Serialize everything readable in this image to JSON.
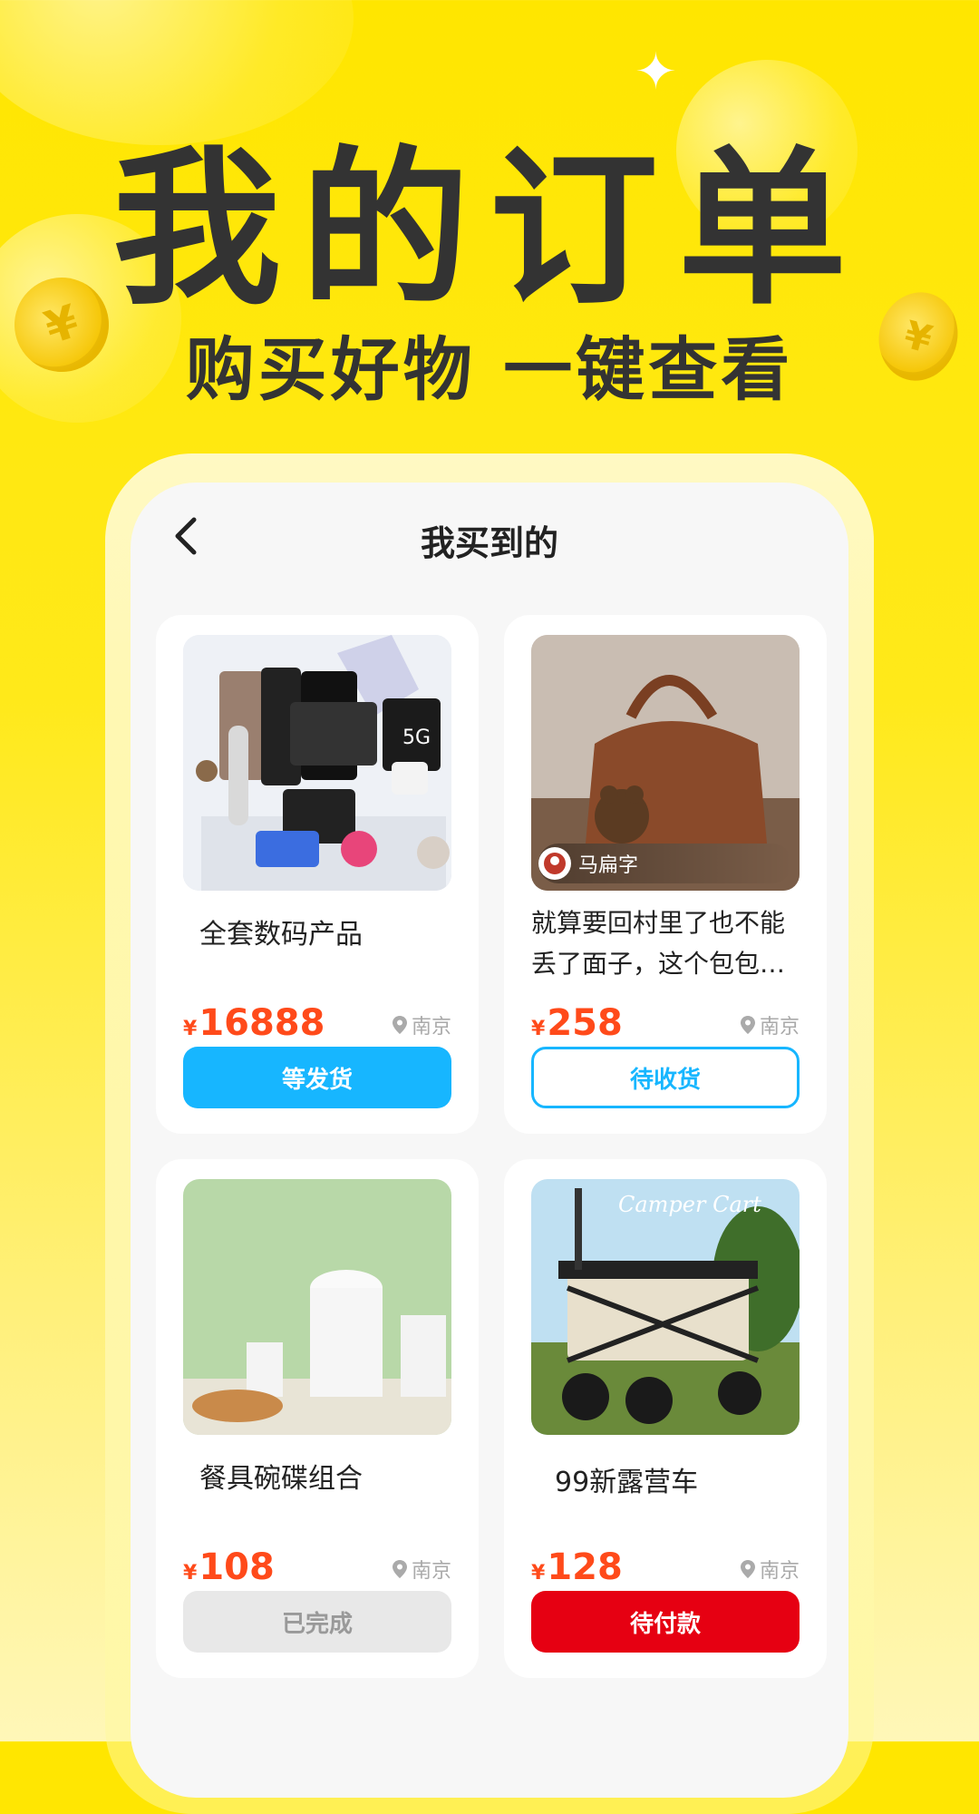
{
  "hero": {
    "title": "我的订单",
    "subtitle": "购买好物 一键查看"
  },
  "decor": {
    "coin_symbol": "¥",
    "sparkle": "✦"
  },
  "nav": {
    "title": "我买到的",
    "back_icon": "chevron-left-icon"
  },
  "orders": [
    {
      "name": "全套数码产品",
      "currency": "¥",
      "price": "16888",
      "location": "南京",
      "status": "等发货",
      "image": "digital-products-photo"
    },
    {
      "name": "就算要回村里了也不能丢了面子，这个包包必…",
      "seller": "马扁字",
      "currency": "¥",
      "price": "258",
      "location": "南京",
      "status": "待收货",
      "image": "brown-handbag-photo"
    },
    {
      "name": "餐具碗碟组合",
      "currency": "¥",
      "price": "108",
      "location": "南京",
      "status": "已完成",
      "image": "tableware-photo"
    },
    {
      "name": "99新露营车",
      "currency": "¥",
      "price": "128",
      "location": "南京",
      "status": "待付款",
      "image": "camping-cart-photo",
      "image_text": "Camper Cart"
    }
  ],
  "colors": {
    "background": "#ffe600",
    "price": "#ff4a1a",
    "blue": "#17b6ff",
    "red": "#e60012",
    "gray": "#e8e8e8"
  }
}
